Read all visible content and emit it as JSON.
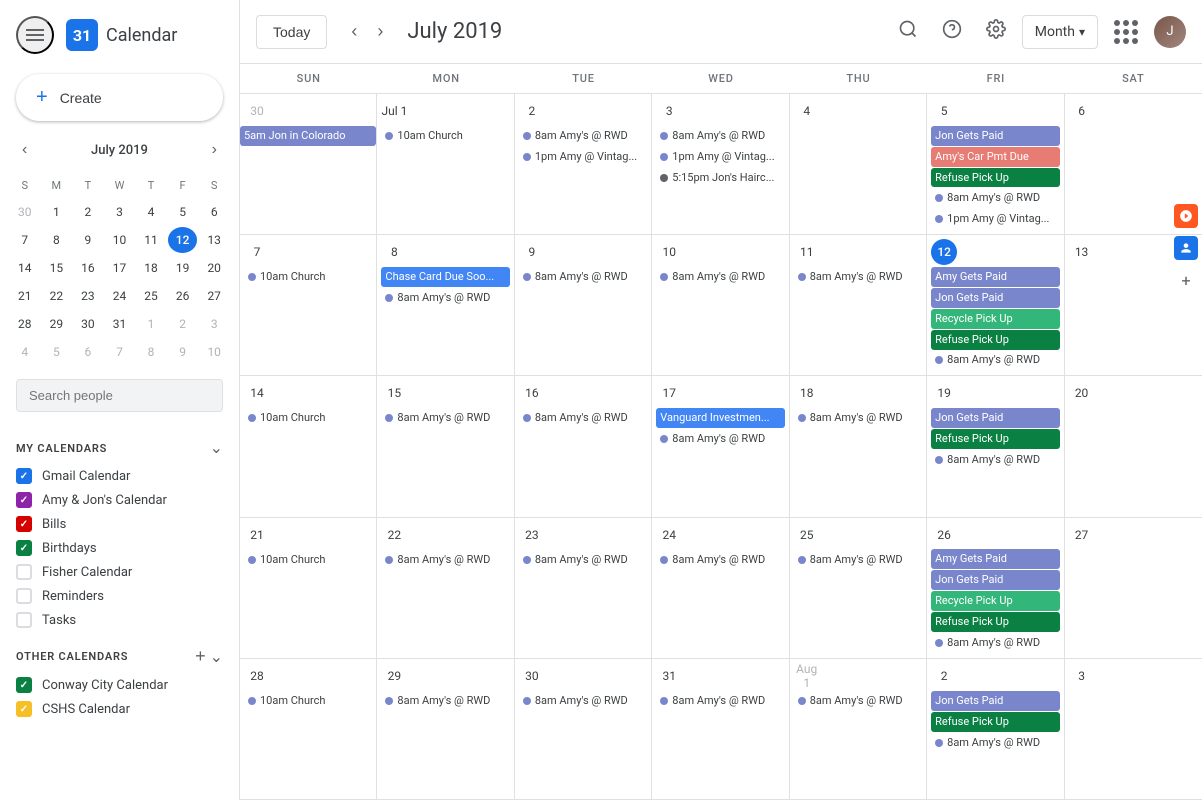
{
  "header": {
    "title": "Calendar",
    "today_label": "Today",
    "month_year": "July 2019",
    "view_label": "Month",
    "search_placeholder": "Search people"
  },
  "mini_cal": {
    "title": "July 2019",
    "days_of_week": [
      "S",
      "M",
      "T",
      "W",
      "T",
      "F",
      "S"
    ],
    "weeks": [
      [
        {
          "num": "30",
          "other": true
        },
        {
          "num": "1"
        },
        {
          "num": "2"
        },
        {
          "num": "3"
        },
        {
          "num": "4"
        },
        {
          "num": "5"
        },
        {
          "num": "6"
        }
      ],
      [
        {
          "num": "7"
        },
        {
          "num": "8"
        },
        {
          "num": "9"
        },
        {
          "num": "10"
        },
        {
          "num": "11"
        },
        {
          "num": "12",
          "today": true
        },
        {
          "num": "13"
        }
      ],
      [
        {
          "num": "14"
        },
        {
          "num": "15"
        },
        {
          "num": "16"
        },
        {
          "num": "17"
        },
        {
          "num": "18"
        },
        {
          "num": "19"
        },
        {
          "num": "20"
        }
      ],
      [
        {
          "num": "21"
        },
        {
          "num": "22"
        },
        {
          "num": "23"
        },
        {
          "num": "24"
        },
        {
          "num": "25"
        },
        {
          "num": "26"
        },
        {
          "num": "27"
        }
      ],
      [
        {
          "num": "28"
        },
        {
          "num": "29"
        },
        {
          "num": "30"
        },
        {
          "num": "31"
        },
        {
          "num": "1",
          "other": true
        },
        {
          "num": "2",
          "other": true
        },
        {
          "num": "3",
          "other": true
        }
      ],
      [
        {
          "num": "4",
          "other": true
        },
        {
          "num": "5",
          "other": true
        },
        {
          "num": "6",
          "other": true
        },
        {
          "num": "7",
          "other": true
        },
        {
          "num": "8",
          "other": true
        },
        {
          "num": "9",
          "other": true
        },
        {
          "num": "10",
          "other": true
        }
      ]
    ]
  },
  "my_calendars": {
    "title": "My calendars",
    "items": [
      {
        "label": "Gmail Calendar",
        "color": "#1a73e8",
        "checked": true
      },
      {
        "label": "Amy & Jon's Calendar",
        "color": "#8e24aa",
        "checked": true
      },
      {
        "label": "Bills",
        "color": "#d50000",
        "checked": true
      },
      {
        "label": "Birthdays",
        "color": "#0b8043",
        "checked": true
      },
      {
        "label": "Fisher Calendar",
        "color": "#ffffff",
        "checked": false
      },
      {
        "label": "Reminders",
        "color": "#ffffff",
        "checked": false
      },
      {
        "label": "Tasks",
        "color": "#ffffff",
        "checked": false
      }
    ]
  },
  "other_calendars": {
    "title": "Other calendars",
    "items": [
      {
        "label": "Conway City Calendar",
        "color": "#0b8043",
        "checked": true
      },
      {
        "label": "CSHS Calendar",
        "color": "#f6bf26",
        "checked": true
      }
    ]
  },
  "calendar": {
    "day_headers": [
      "SUN",
      "MON",
      "TUE",
      "WED",
      "THU",
      "FRI",
      "SAT"
    ],
    "weeks": [
      {
        "days": [
          {
            "num": "30",
            "other": true,
            "events": [
              {
                "text": "5am Jon in Colorado",
                "type": "multi purple"
              }
            ]
          },
          {
            "num": "Jul 1",
            "events": [
              {
                "text": "10am Church",
                "type": "dot-style dot-purple"
              },
              {
                "text": "",
                "type": ""
              }
            ]
          },
          {
            "num": "2",
            "events": [
              {
                "text": "8am Amy's @ RWD",
                "type": "dot-style dot-purple"
              },
              {
                "text": "1pm Amy @ Vintag...",
                "type": "dot-style dot-purple"
              }
            ]
          },
          {
            "num": "3",
            "events": [
              {
                "text": "8am Amy's @ RWD",
                "type": "dot-style dot-purple"
              },
              {
                "text": "1pm Amy @ Vintag...",
                "type": "dot-style dot-purple"
              },
              {
                "text": "5:15pm Jon's Hairc...",
                "type": "dot-style dot-gray"
              }
            ]
          },
          {
            "num": "4",
            "events": []
          },
          {
            "num": "5",
            "events": [
              {
                "text": "Jon Gets Paid",
                "type": "purple"
              },
              {
                "text": "Amy's Car Pmt Due",
                "type": "pink"
              },
              {
                "text": "Refuse Pick Up",
                "type": "green"
              },
              {
                "text": "8am Amy's @ RWD",
                "type": "dot-style dot-purple"
              },
              {
                "text": "1pm Amy @ Vintag...",
                "type": "dot-style dot-purple"
              }
            ]
          },
          {
            "num": "6",
            "events": []
          }
        ]
      },
      {
        "days": [
          {
            "num": "7",
            "events": [
              {
                "text": "10am Church",
                "type": "dot-style dot-purple"
              }
            ]
          },
          {
            "num": "8",
            "events": [
              {
                "text": "Chase Card Due Soo...",
                "type": "blue"
              },
              {
                "text": "8am Amy's @ RWD",
                "type": "dot-style dot-purple"
              }
            ]
          },
          {
            "num": "9",
            "events": [
              {
                "text": "8am Amy's @ RWD",
                "type": "dot-style dot-purple"
              }
            ]
          },
          {
            "num": "10",
            "events": [
              {
                "text": "8am Amy's @ RWD",
                "type": "dot-style dot-purple"
              }
            ]
          },
          {
            "num": "11",
            "events": [
              {
                "text": "8am Amy's @ RWD",
                "type": "dot-style dot-purple"
              }
            ]
          },
          {
            "num": "12",
            "today": true,
            "events": [
              {
                "text": "Amy Gets Paid",
                "type": "purple"
              },
              {
                "text": "Jon Gets Paid",
                "type": "purple"
              },
              {
                "text": "Recycle Pick Up",
                "type": "teal"
              },
              {
                "text": "Refuse Pick Up",
                "type": "green"
              },
              {
                "text": "8am Amy's @ RWD",
                "type": "dot-style dot-purple"
              }
            ]
          },
          {
            "num": "13",
            "events": []
          }
        ]
      },
      {
        "days": [
          {
            "num": "14",
            "events": [
              {
                "text": "10am Church",
                "type": "dot-style dot-purple"
              }
            ]
          },
          {
            "num": "15",
            "events": [
              {
                "text": "8am Amy's @ RWD",
                "type": "dot-style dot-purple"
              }
            ]
          },
          {
            "num": "16",
            "events": [
              {
                "text": "8am Amy's @ RWD",
                "type": "dot-style dot-purple"
              }
            ]
          },
          {
            "num": "17",
            "events": [
              {
                "text": "Vanguard Investmen...",
                "type": "blue"
              },
              {
                "text": "8am Amy's @ RWD",
                "type": "dot-style dot-purple"
              }
            ]
          },
          {
            "num": "18",
            "events": [
              {
                "text": "8am Amy's @ RWD",
                "type": "dot-style dot-purple"
              }
            ]
          },
          {
            "num": "19",
            "events": [
              {
                "text": "Jon Gets Paid",
                "type": "purple"
              },
              {
                "text": "Refuse Pick Up",
                "type": "green"
              },
              {
                "text": "8am Amy's @ RWD",
                "type": "dot-style dot-purple"
              }
            ]
          },
          {
            "num": "20",
            "events": []
          }
        ]
      },
      {
        "days": [
          {
            "num": "21",
            "events": [
              {
                "text": "10am Church",
                "type": "dot-style dot-purple"
              }
            ]
          },
          {
            "num": "22",
            "events": [
              {
                "text": "8am Amy's @ RWD",
                "type": "dot-style dot-purple"
              }
            ]
          },
          {
            "num": "23",
            "events": [
              {
                "text": "8am Amy's @ RWD",
                "type": "dot-style dot-purple"
              }
            ]
          },
          {
            "num": "24",
            "events": [
              {
                "text": "8am Amy's @ RWD",
                "type": "dot-style dot-purple"
              }
            ]
          },
          {
            "num": "25",
            "events": [
              {
                "text": "8am Amy's @ RWD",
                "type": "dot-style dot-purple"
              }
            ]
          },
          {
            "num": "26",
            "events": [
              {
                "text": "Amy Gets Paid",
                "type": "purple"
              },
              {
                "text": "Jon Gets Paid",
                "type": "purple"
              },
              {
                "text": "Recycle Pick Up",
                "type": "teal"
              },
              {
                "text": "Refuse Pick Up",
                "type": "green"
              },
              {
                "text": "8am Amy's @ RWD",
                "type": "dot-style dot-purple"
              }
            ]
          },
          {
            "num": "27",
            "events": []
          }
        ]
      },
      {
        "days": [
          {
            "num": "28",
            "events": [
              {
                "text": "10am Church",
                "type": "dot-style dot-purple"
              }
            ]
          },
          {
            "num": "29",
            "events": [
              {
                "text": "8am Amy's @ RWD",
                "type": "dot-style dot-purple"
              }
            ]
          },
          {
            "num": "30",
            "events": [
              {
                "text": "8am Amy's @ RWD",
                "type": "dot-style dot-purple"
              }
            ]
          },
          {
            "num": "31",
            "events": [
              {
                "text": "8am Amy's @ RWD",
                "type": "dot-style dot-purple"
              }
            ]
          },
          {
            "num": "Aug 1",
            "other": true,
            "events": [
              {
                "text": "8am Amy's @ RWD",
                "type": "dot-style dot-purple"
              }
            ]
          },
          {
            "num": "2",
            "other": false,
            "events": [
              {
                "text": "Jon Gets Paid",
                "type": "purple"
              },
              {
                "text": "Refuse Pick Up",
                "type": "green"
              },
              {
                "text": "8am Amy's @ RWD",
                "type": "dot-style dot-purple"
              }
            ]
          },
          {
            "num": "3",
            "other": false,
            "events": []
          }
        ]
      }
    ]
  }
}
